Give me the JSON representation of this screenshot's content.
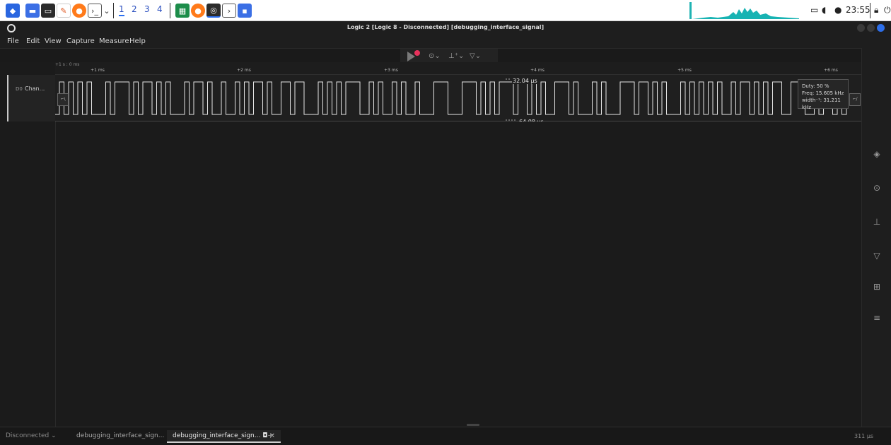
{
  "os_panel": {
    "workspaces": [
      "1",
      "2",
      "3",
      "4"
    ],
    "active_workspace": "1",
    "clock": "23:55"
  },
  "app": {
    "title": "Logic 2 [Logic 8 - Disconnected] [debugging_interface_signal]",
    "accent_color": "#2d6ee8",
    "record_color": "#e8325c"
  },
  "menu": {
    "items": [
      "File",
      "Edit",
      "View",
      "Capture",
      "Measure",
      "Help"
    ]
  },
  "ruler": {
    "origin_label": "+1 s : 0 ms",
    "ticks": [
      "+1 ms",
      "+2 ms",
      "+3 ms",
      "+4 ms",
      "+5 ms",
      "+6 ms"
    ]
  },
  "channel": {
    "number": "D0",
    "name": "Chan...",
    "measurement_top": "32.04 µs",
    "measurement_bottom": "64.08 µs",
    "edge_left_label": "⌐\\",
    "edge_right_label": "⌐/"
  },
  "tooltip": {
    "duty": "Duty: 50 %",
    "freq": "Freq: 15.605 kHz",
    "width": "width⁻¹: 31.211 kHz"
  },
  "statusbar": {
    "connection": "Disconnected",
    "tabs": [
      "debugging_interface_sign...",
      "debugging_interface_sign..."
    ],
    "add_tab": "+",
    "zoom": "311 µs"
  }
}
